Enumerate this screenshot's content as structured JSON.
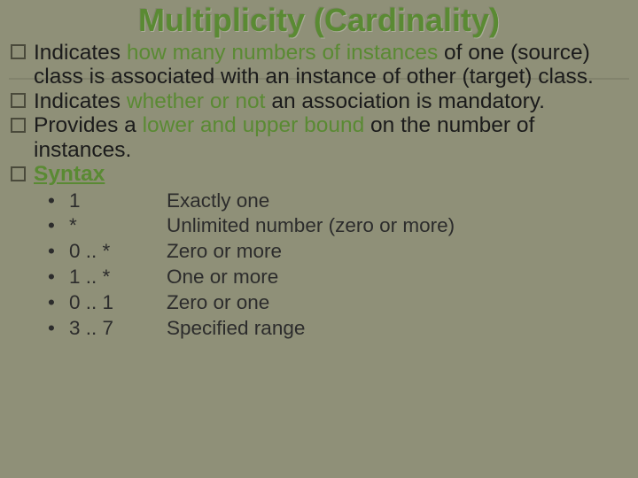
{
  "title": "Multiplicity (Cardinality)",
  "bullets": {
    "b1_pre": "Indicates ",
    "b1_accent": "how many numbers of instances ",
    "b1_post": "of one (source) class is associated with an instance of other (target) class.",
    "b2_pre": "Indicates ",
    "b2_accent": "whether or not ",
    "b2_post": "an association is mandatory.",
    "b3_pre": " Provides a ",
    "b3_accent": "lower and upper bound ",
    "b3_post": "on the number of instances.",
    "b4_accent": "Syntax"
  },
  "syntax": {
    "rows": [
      {
        "sym": "1",
        "desc": "Exactly one"
      },
      {
        "sym": " *",
        "desc": "Unlimited number (zero or more)"
      },
      {
        "sym": " 0 .. *",
        "desc": "Zero or more"
      },
      {
        "sym": "1 .. *",
        "desc": "One or more"
      },
      {
        "sym": " 0 .. 1",
        "desc": "Zero or one"
      },
      {
        "sym": " 3 .. 7",
        "desc": "Specified range"
      }
    ]
  }
}
